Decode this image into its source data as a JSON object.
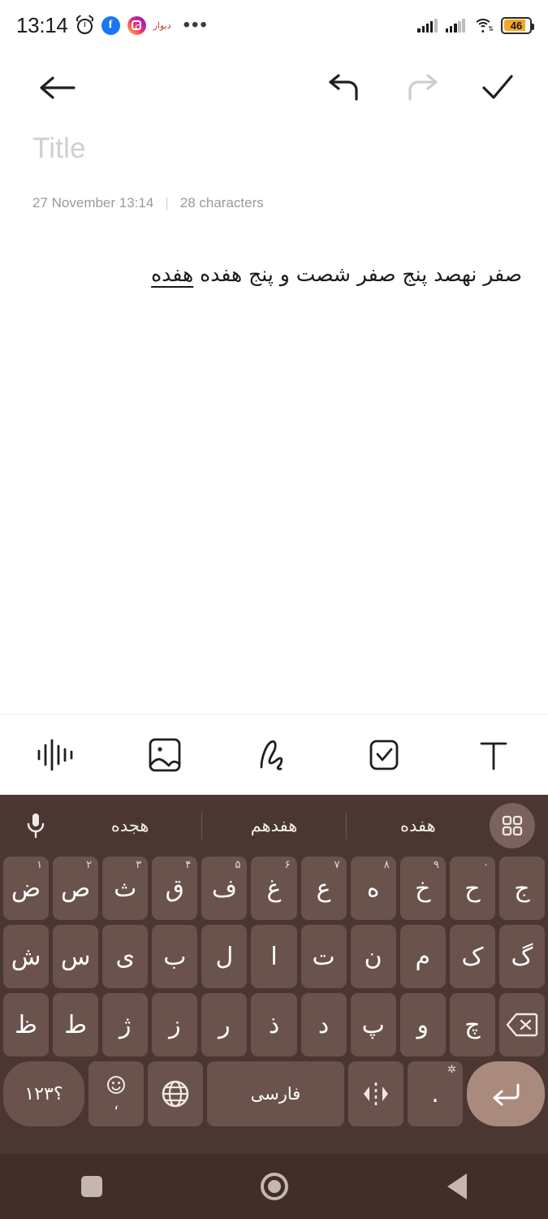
{
  "status_bar": {
    "time": "13:14",
    "icons_left": [
      "alarm-icon",
      "facebook-badge",
      "instagram-badge",
      "divar-badge",
      "more-notifications-icon"
    ],
    "divar_label": "دیوار",
    "more_dots": "•••",
    "battery_level": "46",
    "icons_right": [
      "signal-sim1-icon",
      "signal-sim2-icon",
      "wifi-icon",
      "battery-icon"
    ],
    "colors": {
      "battery_fill": "#f5a623",
      "facebook": "#1877f2"
    }
  },
  "app_toolbar": {
    "back_label": "back-arrow",
    "undo_label": "undo-arrow",
    "redo_label": "redo-arrow",
    "done_label": "done-check"
  },
  "note": {
    "title_placeholder": "Title",
    "title_value": "",
    "date": "27 November 13:14",
    "separator": "|",
    "char_count": "28 characters",
    "body_text": "صفر نهصد پنج صفر شصت و پنج هفده ",
    "body_composing": "هفده"
  },
  "format_toolbar": {
    "items": [
      {
        "name": "audio-icon",
        "label": "Audio"
      },
      {
        "name": "image-icon",
        "label": "Image"
      },
      {
        "name": "draw-icon",
        "label": "Draw"
      },
      {
        "name": "checklist-icon",
        "label": "Checklist"
      },
      {
        "name": "text-format-icon",
        "label": "Text"
      }
    ]
  },
  "keyboard": {
    "colors": {
      "background": "#4b3731",
      "key": "#6a534d",
      "enter_key": "#a98a7c",
      "text": "#ffffff"
    },
    "suggestions": {
      "mic_icon": "microphone-icon",
      "grid_icon": "grid-menu-icon",
      "words": [
        "هفده",
        "هفدهم",
        "هجده"
      ]
    },
    "row1": [
      {
        "key": "ض",
        "sup": "۱"
      },
      {
        "key": "ص",
        "sup": "۲"
      },
      {
        "key": "ث",
        "sup": "۳"
      },
      {
        "key": "ق",
        "sup": "۴"
      },
      {
        "key": "ف",
        "sup": "۵"
      },
      {
        "key": "غ",
        "sup": "۶"
      },
      {
        "key": "ع",
        "sup": "۷"
      },
      {
        "key": "ه",
        "sup": "۸"
      },
      {
        "key": "خ",
        "sup": "۹"
      },
      {
        "key": "ح",
        "sup": "۰"
      },
      {
        "key": "ج",
        "sup": ""
      }
    ],
    "row2": [
      "ش",
      "س",
      "ی",
      "ب",
      "ل",
      "ا",
      "ت",
      "ن",
      "م",
      "ک",
      "گ"
    ],
    "row3": [
      "ظ",
      "ط",
      "ژ",
      "ز",
      "ر",
      "ذ",
      "د",
      "پ",
      "و",
      "چ"
    ],
    "row3_backspace": "backspace-icon",
    "row4": {
      "symbols_label": "۱۲۳؟",
      "emoji_icon": "emoji-icon",
      "emoji_comma": "،",
      "globe_icon": "globe-icon",
      "space_label": "فارسی",
      "cursor_icon": "cursor-move-icon",
      "period_label": ".",
      "period_sup": "settings-icon",
      "enter_icon": "enter-icon"
    }
  },
  "nav_bar": {
    "recents_label": "recents-button",
    "home_label": "home-button",
    "back_label": "back-button"
  }
}
